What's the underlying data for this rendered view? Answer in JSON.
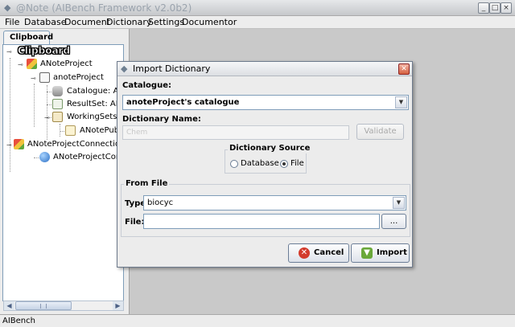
{
  "window": {
    "title": "@Note (AIBench Framework v2.0b2)",
    "min": "_",
    "max": "□",
    "close": "×"
  },
  "menu": [
    "File",
    "Database",
    "Document",
    "Dictionary",
    "Settings",
    "Documentor"
  ],
  "left_panel": {
    "tab": "Clipboard",
    "tree": [
      {
        "label": "Clipboard",
        "icon": "clipboard-title-icon"
      },
      {
        "label": "ANoteProject",
        "icon": "project-icon"
      },
      {
        "label": "anoteProject",
        "icon": "project-folder-icon"
      },
      {
        "label": "Catalogue: ANo",
        "icon": "database-icon"
      },
      {
        "label": "ResultSet: ANo",
        "icon": "resultset-icon"
      },
      {
        "label": "WorkingSets: A",
        "icon": "workingsets-icon"
      },
      {
        "label": "ANotePublic",
        "icon": "document-icon"
      },
      {
        "label": "ANoteProjectConnectio",
        "icon": "project-icon"
      },
      {
        "label": "ANoteProjectConne",
        "icon": "globe-icon"
      }
    ]
  },
  "dialog": {
    "title": "Import Dictionary",
    "catalogue_label": "Catalogue:",
    "catalogue_value": "anoteProject's catalogue",
    "name_label": "Dictionary Name:",
    "name_placeholder": "Chem",
    "validate_label": "Validate",
    "source_legend": "Dictionary Source",
    "source_options": [
      "Database",
      "File"
    ],
    "source_selected": "File",
    "from_file_legend": "From File",
    "type_label": "Type:",
    "type_value": "biocyc",
    "file_label": "File:",
    "file_value": "",
    "browse_label": "...",
    "cancel_label": "Cancel",
    "import_label": "Import"
  },
  "status": "AIBench"
}
